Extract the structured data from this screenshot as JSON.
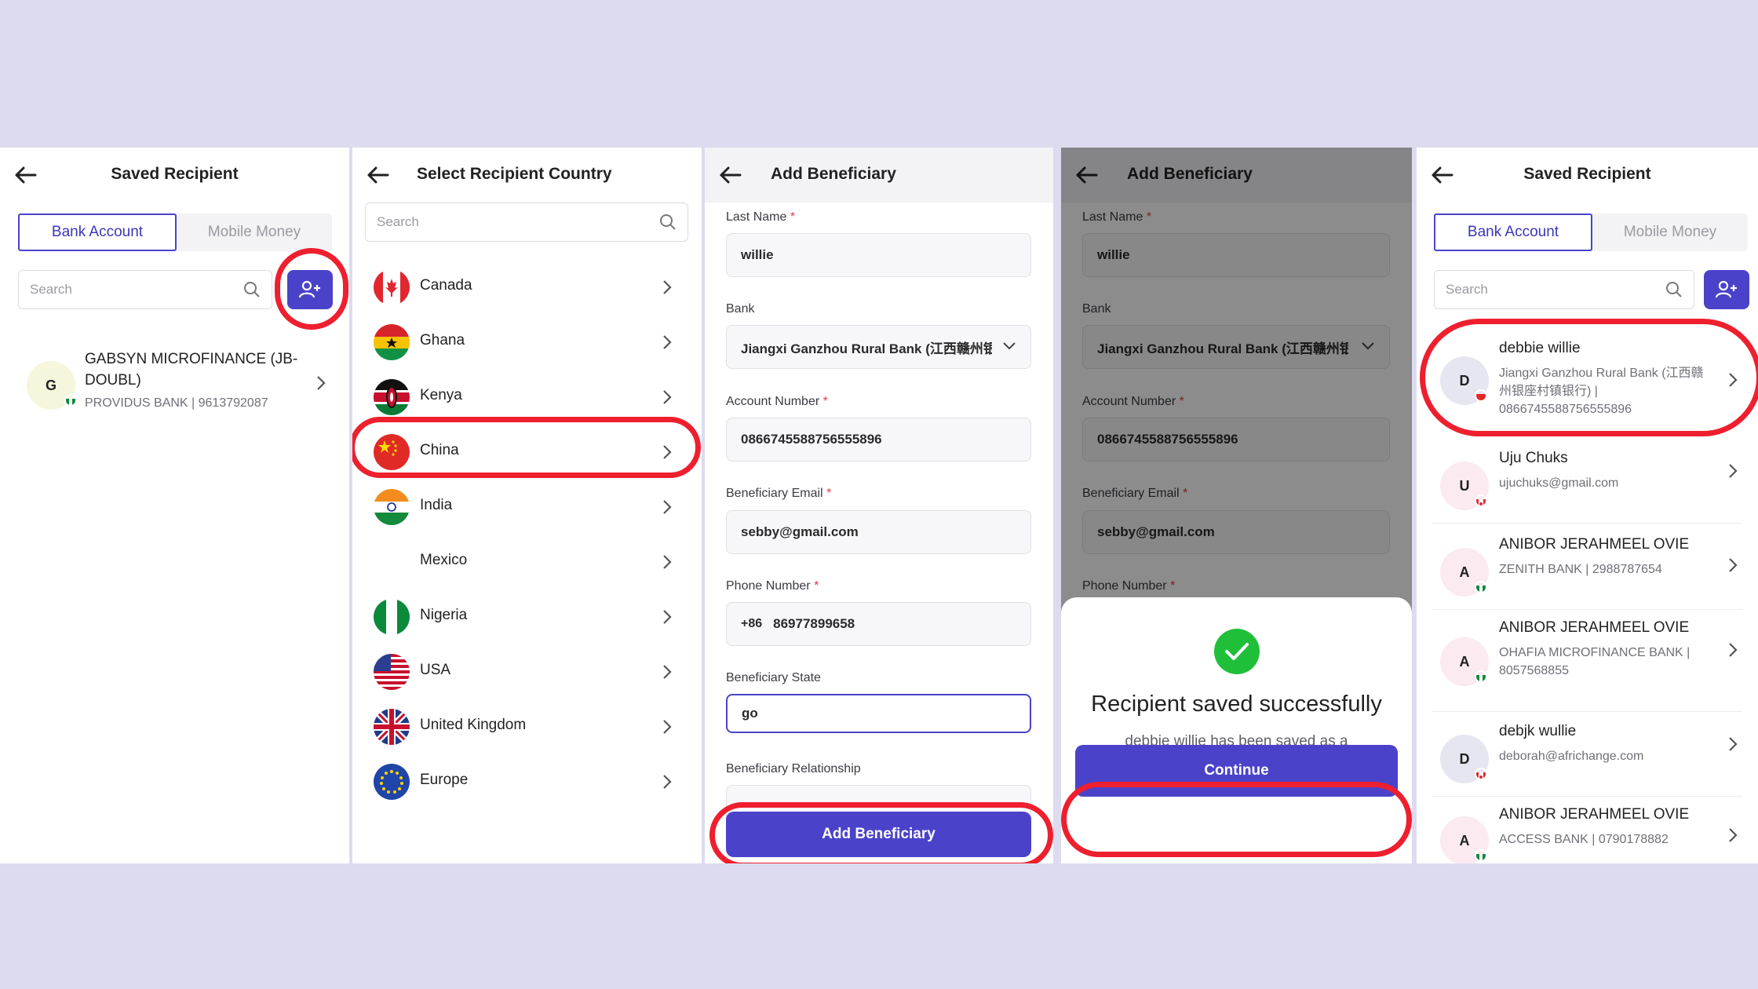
{
  "screen1": {
    "title": "Saved Recipient",
    "tabs": [
      "Bank Account",
      "Mobile Money"
    ],
    "search_placeholder": "Search",
    "recipients": [
      {
        "initial": "G",
        "name_line1": "GABSYN MICROFINANCE (JB-",
        "name_line2": "DOUBL)",
        "sub": "PROVIDUS BANK | 9613792087",
        "flag": "nigeria"
      }
    ]
  },
  "screen2": {
    "title": "Select Recipient Country",
    "search_placeholder": "Search",
    "countries": [
      "Canada",
      "Ghana",
      "Kenya",
      "China",
      "India",
      "Mexico",
      "Nigeria",
      "USA",
      "United Kingdom",
      "Europe"
    ]
  },
  "screen3": {
    "title": "Add Beneficiary",
    "fields": {
      "last_name_label": "Last Name",
      "last_name_value": "willie",
      "bank_label": "Bank",
      "bank_value": "Jiangxi Ganzhou Rural Bank (江西赣州银",
      "account_label": "Account Number",
      "account_value": "0866745588756555896",
      "email_label": "Beneficiary Email",
      "email_value": "sebby@gmail.com",
      "phone_label": "Phone Number",
      "phone_code": "+86",
      "phone_value": "86977899658",
      "state_label": "Beneficiary State",
      "state_value": "go",
      "relationship_label": "Beneficiary Relationship"
    },
    "required_mark": "*",
    "submit_label": "Add Beneficiary"
  },
  "screen4": {
    "title": "Add Beneficiary",
    "modal": {
      "title": "Recipient saved successfully",
      "message": "debbie willie has been saved as a Recipient.",
      "button": "Continue"
    }
  },
  "screen5": {
    "title": "Saved Recipient",
    "tabs": [
      "Bank Account",
      "Mobile Money"
    ],
    "search_placeholder": "Search",
    "recipients": [
      {
        "initial": "D",
        "name": "debbie willie",
        "sub_line1": "Jiangxi Ganzhou Rural Bank (江西赣",
        "sub_line2": "州银座村镇银行) |",
        "sub_line3": "0866745588756555896",
        "flag": "china"
      },
      {
        "initial": "U",
        "name": "Uju Chuks",
        "sub_line1": "ujuchuks@gmail.com",
        "flag": "canada"
      },
      {
        "initial": "A",
        "name": "ANIBOR JERAHMEEL OVIE",
        "sub_line1": "ZENITH BANK | 2988787654",
        "flag": "nigeria"
      },
      {
        "initial": "A",
        "name": "ANIBOR JERAHMEEL OVIE",
        "sub_line1": "OHAFIA MICROFINANCE BANK |",
        "sub_line2": "8057568855",
        "flag": "nigeria"
      },
      {
        "initial": "D",
        "name": "debjk wullie",
        "sub_line1": "deborah@africhange.com",
        "flag": "canada"
      },
      {
        "initial": "A",
        "name": "ANIBOR JERAHMEEL OVIE",
        "sub_line1": "ACCESS BANK | 0790178882",
        "flag": "nigeria"
      }
    ]
  },
  "colors": {
    "accent": "#4a43c9",
    "highlight": "#ee1f2e",
    "success": "#1fbf3a",
    "background": "#dddbef"
  }
}
